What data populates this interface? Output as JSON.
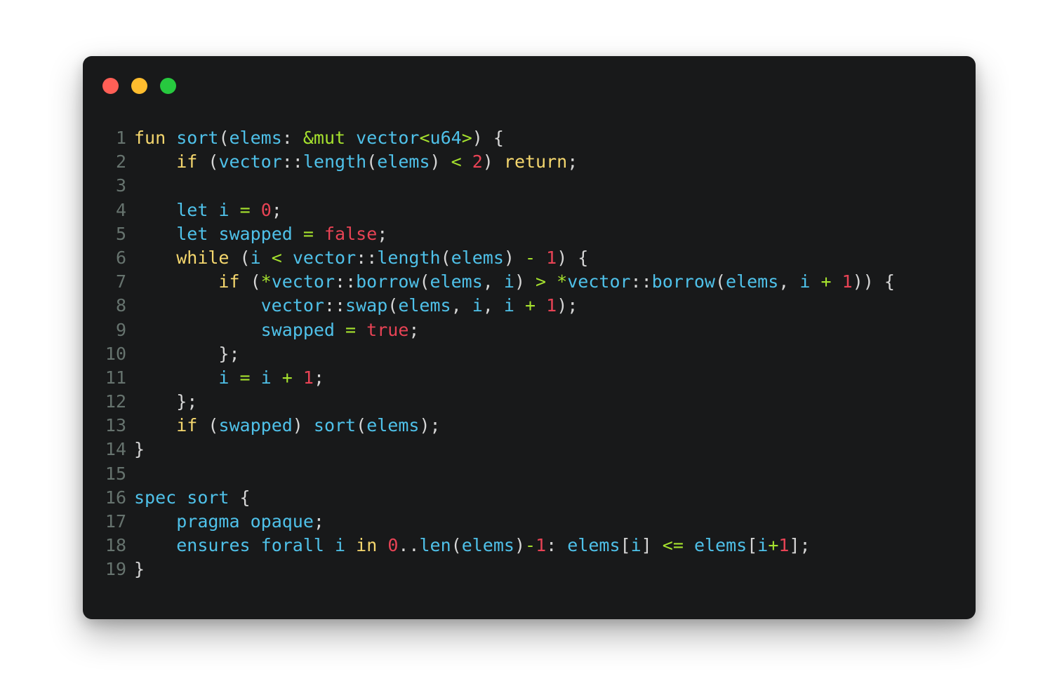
{
  "window": {
    "title": "",
    "background_color": "#18191a",
    "page_background_color": "#ffffff",
    "traffic_lights": [
      {
        "name": "close",
        "color": "#ff5f56"
      },
      {
        "name": "minimize",
        "color": "#ffbd2e"
      },
      {
        "name": "maximize",
        "color": "#27c93f"
      }
    ]
  },
  "editor": {
    "language": "move",
    "theme_colors": {
      "keyword": "#f5d76e",
      "identifier": "#4fc1e9",
      "operator": "#a6e22e",
      "number": "#e84355",
      "punctuation": "#d6d6d6",
      "line_number": "#66736e",
      "background": "#18191a"
    },
    "line_numbers": [
      "1",
      "2",
      "3",
      "4",
      "5",
      "6",
      "7",
      "8",
      "9",
      "10",
      "11",
      "12",
      "13",
      "14",
      "15",
      "16",
      "17",
      "18",
      "19"
    ],
    "lines": [
      {
        "number": "1",
        "text": "fun sort(elems: &mut vector<u64>) {",
        "tokens": [
          {
            "t": "fun",
            "c": "kw"
          },
          {
            "t": " ",
            "c": "pun"
          },
          {
            "t": "sort",
            "c": "fn"
          },
          {
            "t": "(",
            "c": "pun"
          },
          {
            "t": "elems",
            "c": "fn"
          },
          {
            "t": ": ",
            "c": "pun"
          },
          {
            "t": "&mut",
            "c": "op"
          },
          {
            "t": " ",
            "c": "pun"
          },
          {
            "t": "vector",
            "c": "fn"
          },
          {
            "t": "<",
            "c": "op"
          },
          {
            "t": "u64",
            "c": "fn"
          },
          {
            "t": ">",
            "c": "op"
          },
          {
            "t": ") {",
            "c": "pun"
          }
        ]
      },
      {
        "number": "2",
        "text": "    if (vector::length(elems) < 2) return;",
        "tokens": [
          {
            "t": "    ",
            "c": "pun"
          },
          {
            "t": "if",
            "c": "kw"
          },
          {
            "t": " (",
            "c": "pun"
          },
          {
            "t": "vector",
            "c": "fn"
          },
          {
            "t": "::",
            "c": "pun"
          },
          {
            "t": "length",
            "c": "fn"
          },
          {
            "t": "(",
            "c": "pun"
          },
          {
            "t": "elems",
            "c": "fn"
          },
          {
            "t": ") ",
            "c": "pun"
          },
          {
            "t": "<",
            "c": "op"
          },
          {
            "t": " ",
            "c": "pun"
          },
          {
            "t": "2",
            "c": "num"
          },
          {
            "t": ") ",
            "c": "pun"
          },
          {
            "t": "return",
            "c": "kw"
          },
          {
            "t": ";",
            "c": "pun"
          }
        ]
      },
      {
        "number": "3",
        "text": "",
        "tokens": []
      },
      {
        "number": "4",
        "text": "    let i = 0;",
        "tokens": [
          {
            "t": "    ",
            "c": "pun"
          },
          {
            "t": "let",
            "c": "fn"
          },
          {
            "t": " ",
            "c": "pun"
          },
          {
            "t": "i",
            "c": "fn"
          },
          {
            "t": " ",
            "c": "pun"
          },
          {
            "t": "=",
            "c": "op"
          },
          {
            "t": " ",
            "c": "pun"
          },
          {
            "t": "0",
            "c": "num"
          },
          {
            "t": ";",
            "c": "pun"
          }
        ]
      },
      {
        "number": "5",
        "text": "    let swapped = false;",
        "tokens": [
          {
            "t": "    ",
            "c": "pun"
          },
          {
            "t": "let",
            "c": "fn"
          },
          {
            "t": " ",
            "c": "pun"
          },
          {
            "t": "swapped",
            "c": "fn"
          },
          {
            "t": " ",
            "c": "pun"
          },
          {
            "t": "=",
            "c": "op"
          },
          {
            "t": " ",
            "c": "pun"
          },
          {
            "t": "false",
            "c": "num"
          },
          {
            "t": ";",
            "c": "pun"
          }
        ]
      },
      {
        "number": "6",
        "text": "    while (i < vector::length(elems) - 1) {",
        "tokens": [
          {
            "t": "    ",
            "c": "pun"
          },
          {
            "t": "while",
            "c": "kw"
          },
          {
            "t": " (",
            "c": "pun"
          },
          {
            "t": "i",
            "c": "fn"
          },
          {
            "t": " ",
            "c": "pun"
          },
          {
            "t": "<",
            "c": "op"
          },
          {
            "t": " ",
            "c": "pun"
          },
          {
            "t": "vector",
            "c": "fn"
          },
          {
            "t": "::",
            "c": "pun"
          },
          {
            "t": "length",
            "c": "fn"
          },
          {
            "t": "(",
            "c": "pun"
          },
          {
            "t": "elems",
            "c": "fn"
          },
          {
            "t": ") ",
            "c": "pun"
          },
          {
            "t": "-",
            "c": "op"
          },
          {
            "t": " ",
            "c": "pun"
          },
          {
            "t": "1",
            "c": "num"
          },
          {
            "t": ") {",
            "c": "pun"
          }
        ]
      },
      {
        "number": "7",
        "text": "        if (*vector::borrow(elems, i) > *vector::borrow(elems, i + 1)) {",
        "tokens": [
          {
            "t": "        ",
            "c": "pun"
          },
          {
            "t": "if",
            "c": "kw"
          },
          {
            "t": " (",
            "c": "pun"
          },
          {
            "t": "*",
            "c": "op"
          },
          {
            "t": "vector",
            "c": "fn"
          },
          {
            "t": "::",
            "c": "pun"
          },
          {
            "t": "borrow",
            "c": "fn"
          },
          {
            "t": "(",
            "c": "pun"
          },
          {
            "t": "elems",
            "c": "fn"
          },
          {
            "t": ", ",
            "c": "pun"
          },
          {
            "t": "i",
            "c": "fn"
          },
          {
            "t": ") ",
            "c": "pun"
          },
          {
            "t": ">",
            "c": "op"
          },
          {
            "t": " ",
            "c": "pun"
          },
          {
            "t": "*",
            "c": "op"
          },
          {
            "t": "vector",
            "c": "fn"
          },
          {
            "t": "::",
            "c": "pun"
          },
          {
            "t": "borrow",
            "c": "fn"
          },
          {
            "t": "(",
            "c": "pun"
          },
          {
            "t": "elems",
            "c": "fn"
          },
          {
            "t": ", ",
            "c": "pun"
          },
          {
            "t": "i",
            "c": "fn"
          },
          {
            "t": " ",
            "c": "pun"
          },
          {
            "t": "+",
            "c": "op"
          },
          {
            "t": " ",
            "c": "pun"
          },
          {
            "t": "1",
            "c": "num"
          },
          {
            "t": ")) {",
            "c": "pun"
          }
        ]
      },
      {
        "number": "8",
        "text": "            vector::swap(elems, i, i + 1);",
        "tokens": [
          {
            "t": "            ",
            "c": "pun"
          },
          {
            "t": "vector",
            "c": "fn"
          },
          {
            "t": "::",
            "c": "pun"
          },
          {
            "t": "swap",
            "c": "fn"
          },
          {
            "t": "(",
            "c": "pun"
          },
          {
            "t": "elems",
            "c": "fn"
          },
          {
            "t": ", ",
            "c": "pun"
          },
          {
            "t": "i",
            "c": "fn"
          },
          {
            "t": ", ",
            "c": "pun"
          },
          {
            "t": "i",
            "c": "fn"
          },
          {
            "t": " ",
            "c": "pun"
          },
          {
            "t": "+",
            "c": "op"
          },
          {
            "t": " ",
            "c": "pun"
          },
          {
            "t": "1",
            "c": "num"
          },
          {
            "t": ");",
            "c": "pun"
          }
        ]
      },
      {
        "number": "9",
        "text": "            swapped = true;",
        "tokens": [
          {
            "t": "            ",
            "c": "pun"
          },
          {
            "t": "swapped",
            "c": "fn"
          },
          {
            "t": " ",
            "c": "pun"
          },
          {
            "t": "=",
            "c": "op"
          },
          {
            "t": " ",
            "c": "pun"
          },
          {
            "t": "true",
            "c": "num"
          },
          {
            "t": ";",
            "c": "pun"
          }
        ]
      },
      {
        "number": "10",
        "text": "        };",
        "tokens": [
          {
            "t": "        };",
            "c": "pun"
          }
        ]
      },
      {
        "number": "11",
        "text": "        i = i + 1;",
        "tokens": [
          {
            "t": "        ",
            "c": "pun"
          },
          {
            "t": "i",
            "c": "fn"
          },
          {
            "t": " ",
            "c": "pun"
          },
          {
            "t": "=",
            "c": "op"
          },
          {
            "t": " ",
            "c": "pun"
          },
          {
            "t": "i",
            "c": "fn"
          },
          {
            "t": " ",
            "c": "pun"
          },
          {
            "t": "+",
            "c": "op"
          },
          {
            "t": " ",
            "c": "pun"
          },
          {
            "t": "1",
            "c": "num"
          },
          {
            "t": ";",
            "c": "pun"
          }
        ]
      },
      {
        "number": "12",
        "text": "    };",
        "tokens": [
          {
            "t": "    };",
            "c": "pun"
          }
        ]
      },
      {
        "number": "13",
        "text": "    if (swapped) sort(elems);",
        "tokens": [
          {
            "t": "    ",
            "c": "pun"
          },
          {
            "t": "if",
            "c": "kw"
          },
          {
            "t": " (",
            "c": "pun"
          },
          {
            "t": "swapped",
            "c": "fn"
          },
          {
            "t": ") ",
            "c": "pun"
          },
          {
            "t": "sort",
            "c": "fn"
          },
          {
            "t": "(",
            "c": "pun"
          },
          {
            "t": "elems",
            "c": "fn"
          },
          {
            "t": ");",
            "c": "pun"
          }
        ]
      },
      {
        "number": "14",
        "text": "}",
        "tokens": [
          {
            "t": "}",
            "c": "pun"
          }
        ]
      },
      {
        "number": "15",
        "text": "",
        "tokens": []
      },
      {
        "number": "16",
        "text": "spec sort {",
        "tokens": [
          {
            "t": "spec",
            "c": "fn"
          },
          {
            "t": " ",
            "c": "pun"
          },
          {
            "t": "sort",
            "c": "fn"
          },
          {
            "t": " {",
            "c": "pun"
          }
        ]
      },
      {
        "number": "17",
        "text": "    pragma opaque;",
        "tokens": [
          {
            "t": "    ",
            "c": "pun"
          },
          {
            "t": "pragma",
            "c": "fn"
          },
          {
            "t": " ",
            "c": "pun"
          },
          {
            "t": "opaque",
            "c": "fn"
          },
          {
            "t": ";",
            "c": "pun"
          }
        ]
      },
      {
        "number": "18",
        "text": "    ensures forall i in 0..len(elems)-1: elems[i] <= elems[i+1];",
        "tokens": [
          {
            "t": "    ",
            "c": "pun"
          },
          {
            "t": "ensures",
            "c": "fn"
          },
          {
            "t": " ",
            "c": "pun"
          },
          {
            "t": "forall",
            "c": "fn"
          },
          {
            "t": " ",
            "c": "pun"
          },
          {
            "t": "i",
            "c": "fn"
          },
          {
            "t": " ",
            "c": "pun"
          },
          {
            "t": "in",
            "c": "kw"
          },
          {
            "t": " ",
            "c": "pun"
          },
          {
            "t": "0",
            "c": "num"
          },
          {
            "t": "..",
            "c": "pun"
          },
          {
            "t": "len",
            "c": "fn"
          },
          {
            "t": "(",
            "c": "pun"
          },
          {
            "t": "elems",
            "c": "fn"
          },
          {
            "t": ")",
            "c": "pun"
          },
          {
            "t": "-",
            "c": "op"
          },
          {
            "t": "1",
            "c": "num"
          },
          {
            "t": ": ",
            "c": "pun"
          },
          {
            "t": "elems",
            "c": "fn"
          },
          {
            "t": "[",
            "c": "pun"
          },
          {
            "t": "i",
            "c": "fn"
          },
          {
            "t": "] ",
            "c": "pun"
          },
          {
            "t": "<=",
            "c": "op"
          },
          {
            "t": " ",
            "c": "pun"
          },
          {
            "t": "elems",
            "c": "fn"
          },
          {
            "t": "[",
            "c": "pun"
          },
          {
            "t": "i",
            "c": "fn"
          },
          {
            "t": "+",
            "c": "op"
          },
          {
            "t": "1",
            "c": "num"
          },
          {
            "t": "];",
            "c": "pun"
          }
        ]
      },
      {
        "number": "19",
        "text": "}",
        "tokens": [
          {
            "t": "}",
            "c": "pun"
          }
        ]
      }
    ]
  }
}
